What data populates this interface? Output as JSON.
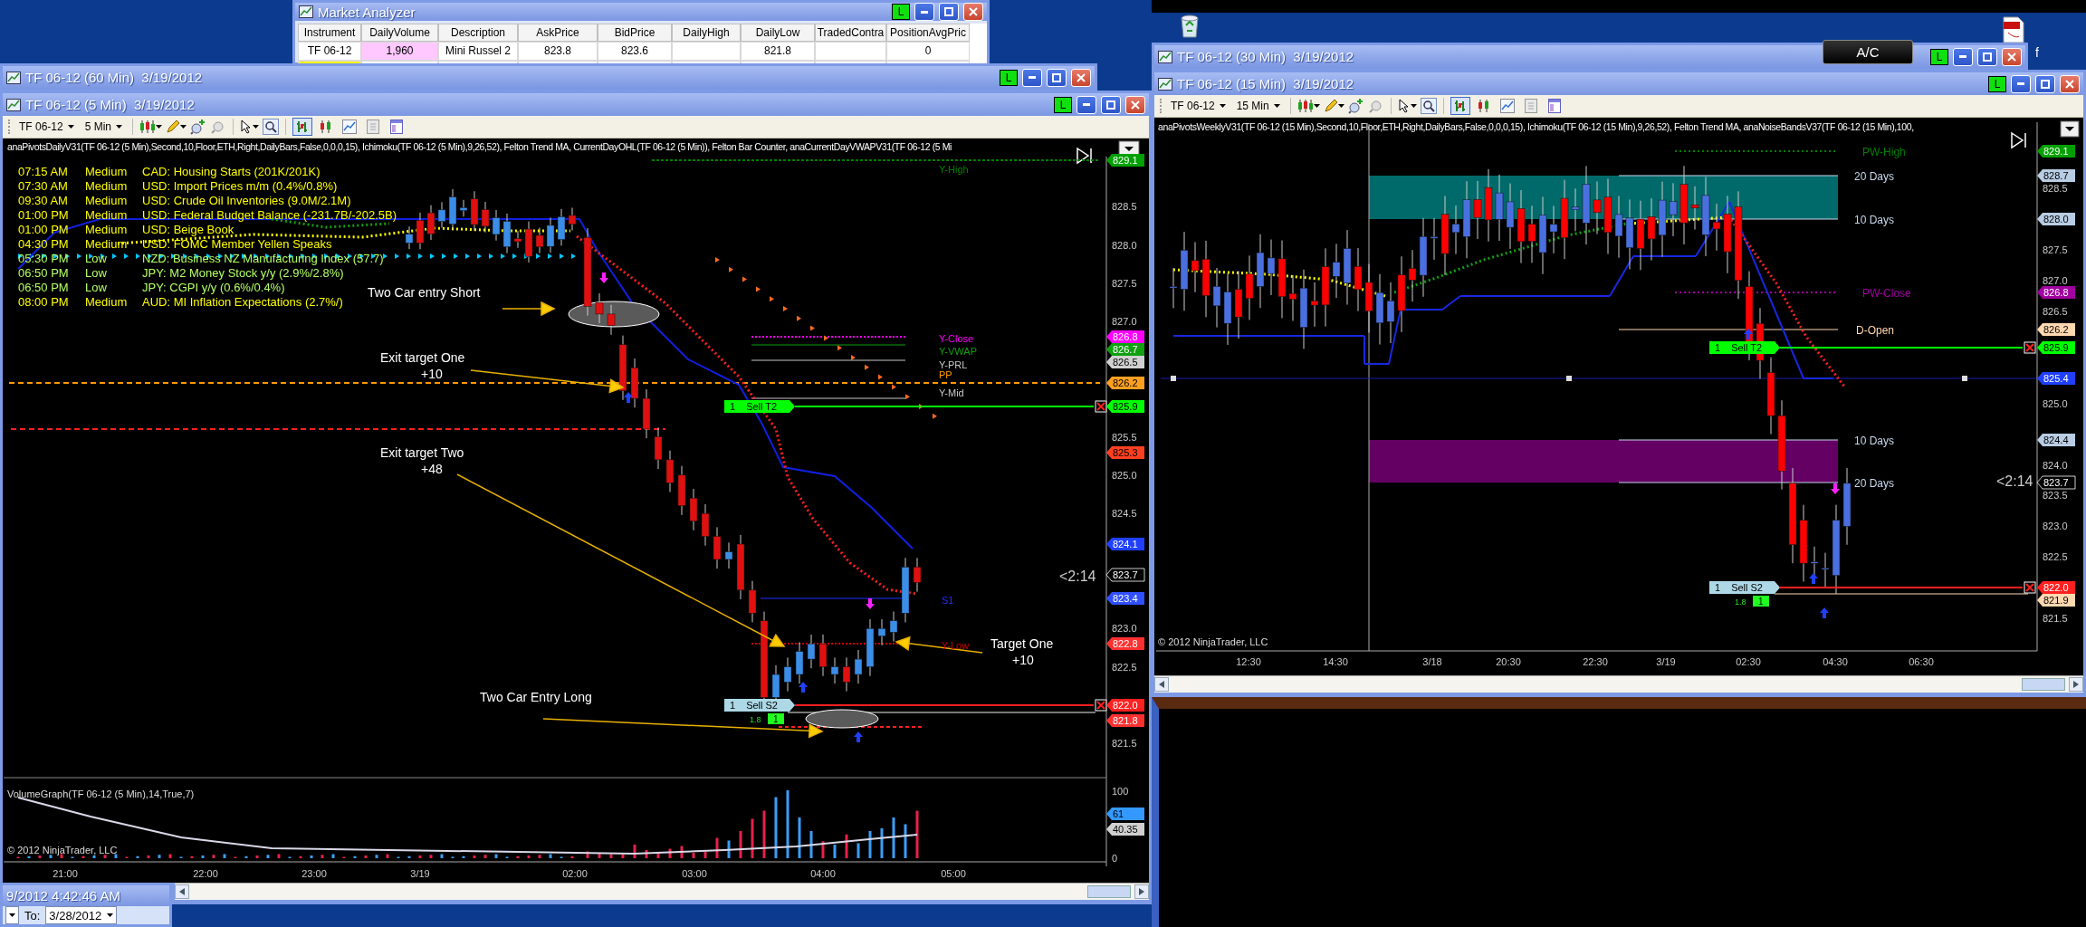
{
  "desktop": {
    "caption_fragment": "f"
  },
  "ac_button": "A/C",
  "market_analyzer": {
    "title": "Market Analyzer",
    "link_button": "L",
    "columns": [
      "Instrument",
      "DailyVolume",
      "Description",
      "AskPrice",
      "BidPrice",
      "DailyHigh",
      "DailyLow",
      "TradedContra",
      "PositionAvgPric"
    ],
    "rows": [
      {
        "cells": [
          {
            "text": "TF 06-12"
          },
          {
            "text": "1,960",
            "color": "#ffc8ff"
          },
          {
            "text": "Mini Russel 2"
          },
          {
            "text": "823.8"
          },
          {
            "text": "823.6"
          },
          null,
          {
            "text": "821.8"
          },
          null,
          {
            "text": "0"
          }
        ]
      },
      {
        "cells": [
          {
            "color": "#ffff00"
          },
          null,
          null,
          null,
          null,
          null,
          null,
          null,
          null
        ]
      }
    ]
  },
  "windows_behind": [
    {
      "title": "TF 06-12 (60 Min)  3/19/2012",
      "link_button": "L"
    },
    {
      "title": "TF 06-12 (30 Min)  3/19/2012",
      "link_button": "L"
    }
  ],
  "chart_5min": {
    "title": "TF 06-12 (5 Min)  3/19/2012",
    "link_button": "L",
    "toolbar": {
      "instrument": "TF 06-12",
      "interval": "5 Min",
      "toggles": [
        {
          "kind": "bars",
          "selected": true
        },
        {
          "kind": "candles",
          "selected": false
        },
        {
          "kind": "line",
          "selected": false
        },
        {
          "kind": "money",
          "selected": false
        },
        {
          "kind": "panel",
          "selected": false
        }
      ]
    },
    "indicators": "anaPivotsDailyV31(TF 06-12 (5 Min),Second,10,Floor,ETH,Right,DailyBars,False,0,0,0,15),  Ichimoku(TF 06-12 (5 Min),9,26,52), Felton Trend MA, CurrentDayOHL(TF 06-12 (5 Min)), Felton Bar Counter, anaCurrentDayVWAPV31(TF 06-12 (5 Mi",
    "events": [
      {
        "time": "07:15 AM",
        "impact": "Medium",
        "event": "CAD: Housing Starts (201K/201K)",
        "color": "#ffff00"
      },
      {
        "time": "07:30 AM",
        "impact": "Medium",
        "event": "USD: Import Prices m/m (0.4%/0.8%)",
        "color": "#ffff00"
      },
      {
        "time": "09:30 AM",
        "impact": "Medium",
        "event": "USD: Crude Oil Inventories (9.0M/2.1M)",
        "color": "#ffff00"
      },
      {
        "time": "01:00 PM",
        "impact": "Medium",
        "event": "USD: Federal Budget Balance (-231.7B/-202.5B)",
        "color": "#ffff00"
      },
      {
        "time": "01:00 PM",
        "impact": "Medium",
        "event": "USD: Beige Book",
        "color": "#ffff00"
      },
      {
        "time": "04:30 PM",
        "impact": "Medium",
        "event": "USD: FOMC Member Yellen Speaks",
        "color": "#ffff00"
      },
      {
        "time": "05:30 PM",
        "impact": "Low",
        "event": "NZD: Business NZ Manufacturing Index (57.7)",
        "color": "#b4ff64"
      },
      {
        "time": "06:50 PM",
        "impact": "Low",
        "event": "JPY: M2 Money Stock y/y (2.9%/2.8%)",
        "color": "#b4ff64"
      },
      {
        "time": "06:50 PM",
        "impact": "Low",
        "event": "JPY: CGPI y/y (0.6%/0.4%)",
        "color": "#b4ff64"
      },
      {
        "time": "08:00 PM",
        "impact": "Medium",
        "event": "AUD: MI Inflation Expectations (2.7%/)",
        "color": "#ffff00"
      }
    ],
    "annotations": [
      {
        "lines": [
          "Two Car entry Short"
        ]
      },
      {
        "lines": [
          "Exit target One",
          "+10"
        ]
      },
      {
        "lines": [
          "Exit target Two",
          "+48"
        ]
      },
      {
        "lines": [
          "Target One",
          "+10"
        ]
      },
      {
        "lines": [
          "Two Car Entry Long"
        ]
      }
    ],
    "levels": [
      {
        "label": "Y-High",
        "color": "#008000"
      },
      {
        "label": "Y-Close",
        "color": "#ff00ff"
      },
      {
        "label": "Y-VWAP",
        "color": "#10a010"
      },
      {
        "label": "Y-PRL",
        "color": "#c8c8c8"
      },
      {
        "label": "PP",
        "color": "#ff9900"
      },
      {
        "label": "Y-Mid",
        "color": "#c8c8c8"
      },
      {
        "label": "S1",
        "color": "#2030ff"
      },
      {
        "label": "Y-Low",
        "color": "#cc0000"
      }
    ],
    "orders": [
      {
        "quantity": "1",
        "label": "Sell T2",
        "color": "#00ff00"
      },
      {
        "quantity": "1",
        "label": "Sell S2",
        "color": "#add8e6",
        "fill_price": "1.8",
        "fill_quantity": "1"
      }
    ],
    "countdown": "<2:14",
    "price_ticks": [
      "828.5",
      "828.0",
      "827.5",
      "827.0",
      "825.5",
      "825.0",
      "824.5",
      "823.0",
      "822.5",
      "821.5"
    ],
    "price_markers": [
      {
        "text": "829.1",
        "color": "#00a000"
      },
      {
        "text": "826.8",
        "color": "#ff00ff"
      },
      {
        "text": "826.7",
        "color": "#10a010"
      },
      {
        "text": "826.5",
        "color": "#d0d0d0"
      },
      {
        "text": "826.2",
        "color": "#ffa020"
      },
      {
        "text": "825.9",
        "color": "#00ff00"
      },
      {
        "text": "825.3",
        "color": "#ff4020"
      },
      {
        "text": "824.1",
        "color": "#2040ff"
      },
      {
        "text": "823.7",
        "color": "#000000"
      },
      {
        "text": "823.4",
        "color": "#3050ff"
      },
      {
        "text": "822.8",
        "color": "#ff3030"
      },
      {
        "text": "822.0",
        "color": "#ff2020"
      },
      {
        "text": "821.8",
        "color": "#ff3030"
      }
    ],
    "copyright": "© 2012 NinjaTrader, LLC",
    "volume": {
      "title": "VolumeGraph(TF 06-12 (5 Min),14,True,7)",
      "ticks": [
        "100",
        "0"
      ],
      "markers": [
        {
          "text": "61",
          "color": "#3399ff"
        },
        {
          "text": "40.35",
          "color": "#d0d0d0"
        }
      ]
    },
    "time_labels": [
      "21:00",
      "22:00",
      "23:00",
      "3/19",
      "02:00",
      "03:00",
      "04:00",
      "05:00"
    ]
  },
  "chart_15min": {
    "title": "TF 06-12 (15 Min)  3/19/2012",
    "link_button": "L",
    "toolbar": {
      "instrument": "TF 06-12",
      "interval": "15 Min",
      "toggles": [
        {
          "kind": "bars",
          "selected": true
        },
        {
          "kind": "candles",
          "selected": false
        },
        {
          "kind": "line",
          "selected": false
        },
        {
          "kind": "money",
          "selected": false
        },
        {
          "kind": "panel",
          "selected": false
        }
      ]
    },
    "indicators": "anaPivotsWeeklyV31(TF 06-12 (15 Min),Second,10,Floor,ETH,Right,DailyBars,False,0,0,0,15),  Ichimoku(TF 06-12 (15 Min),9,26,52), Felton Trend MA, anaNoiseBandsV37(TF 06-12 (15 Min),100,",
    "levels": [
      {
        "label": "PW-High",
        "color": "#008000"
      },
      {
        "label": "20 Days",
        "color": "#c8d8ec"
      },
      {
        "label": "10 Days",
        "color": "#c8d8ec"
      },
      {
        "label": "PW-Close",
        "color": "#a000a0"
      },
      {
        "label": "D-Open",
        "color": "#ffd8b0"
      },
      {
        "label": "10 Days",
        "color": "#c8d8ec"
      },
      {
        "label": "20 Days",
        "color": "#c8d8ec"
      }
    ],
    "orders": [
      {
        "quantity": "1",
        "label": "Sell T2",
        "color": "#00ff00"
      },
      {
        "quantity": "1",
        "label": "Sell S2",
        "color": "#add8e6",
        "fill_price": "1.8",
        "fill_quantity": "1"
      }
    ],
    "countdown": "<2:14",
    "price_ticks": [
      "828.5",
      "827.5",
      "827.0",
      "826.5",
      "825.0",
      "824.0",
      "823.5",
      "823.0",
      "822.5",
      "821.5"
    ],
    "price_markers": [
      {
        "text": "829.1",
        "color": "#00a000"
      },
      {
        "text": "828.7",
        "color": "#b8cce4"
      },
      {
        "text": "828.0",
        "color": "#b8cce4"
      },
      {
        "text": "826.8",
        "color": "#a000a0"
      },
      {
        "text": "826.2",
        "color": "#ffd8b0"
      },
      {
        "text": "825.9",
        "color": "#00ff00"
      },
      {
        "text": "825.4",
        "color": "#2040ff"
      },
      {
        "text": "824.4",
        "color": "#b8cce4"
      },
      {
        "text": "823.7",
        "color": "#000000"
      },
      {
        "text": "822.0",
        "color": "#ff2020"
      },
      {
        "text": "821.9",
        "color": "#ffd8b0"
      }
    ],
    "copyright": "© 2012 NinjaTrader, LLC",
    "time_labels": [
      "12:30",
      "14:30",
      "3/18",
      "20:30",
      "22:30",
      "3/19",
      "02:30",
      "04:30",
      "06:30"
    ]
  },
  "date_range_window": {
    "title": "9/2012 4:42:46 AM",
    "to_label": "To:",
    "to_date": "3/28/2012"
  }
}
